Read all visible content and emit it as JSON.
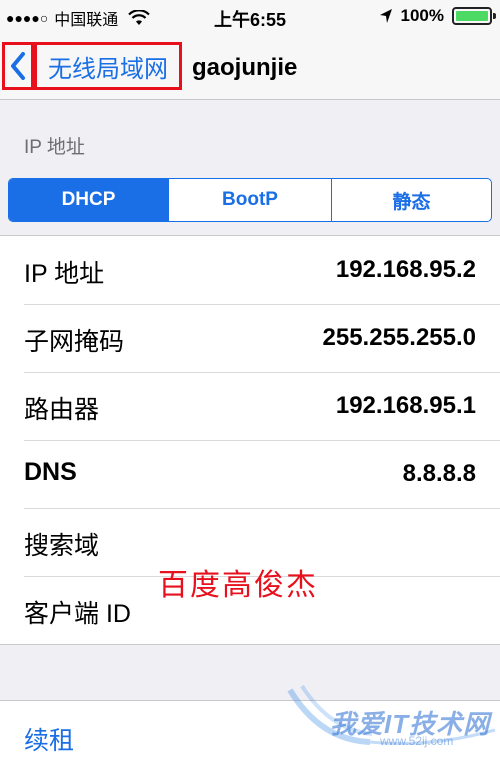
{
  "status_bar": {
    "signal": "●●●●○",
    "carrier": "中国联通",
    "time": "上午6:55",
    "battery": "100%",
    "icons": [
      "wifi-icon",
      "location-icon",
      "battery-icon"
    ]
  },
  "nav": {
    "back_label": "无线局域网",
    "title": "gaojunjie",
    "back_icon": "chevron-left-icon"
  },
  "section_header": "IP 地址",
  "segments": [
    {
      "label": "DHCP",
      "selected": true
    },
    {
      "label": "BootP",
      "selected": false
    },
    {
      "label": "静态",
      "selected": false
    }
  ],
  "rows": [
    {
      "label": "IP 地址",
      "value": "192.168.95.2"
    },
    {
      "label": "子网掩码",
      "value": "255.255.255.0"
    },
    {
      "label": "路由器",
      "value": "192.168.95.1"
    },
    {
      "label": "DNS",
      "value": "8.8.8.8"
    },
    {
      "label": "搜索域",
      "value": ""
    },
    {
      "label": "客户端 ID",
      "value": ""
    }
  ],
  "renew_label": "续租",
  "annotation_text": "百度高俊杰",
  "watermark": {
    "logo_text": "我爱IT技术网",
    "url": "www.52ij.com"
  },
  "colors": {
    "accent": "#1a6ee6",
    "highlight_box": "#e8101c",
    "battery": "#4cd964",
    "background": "#efeff4"
  }
}
